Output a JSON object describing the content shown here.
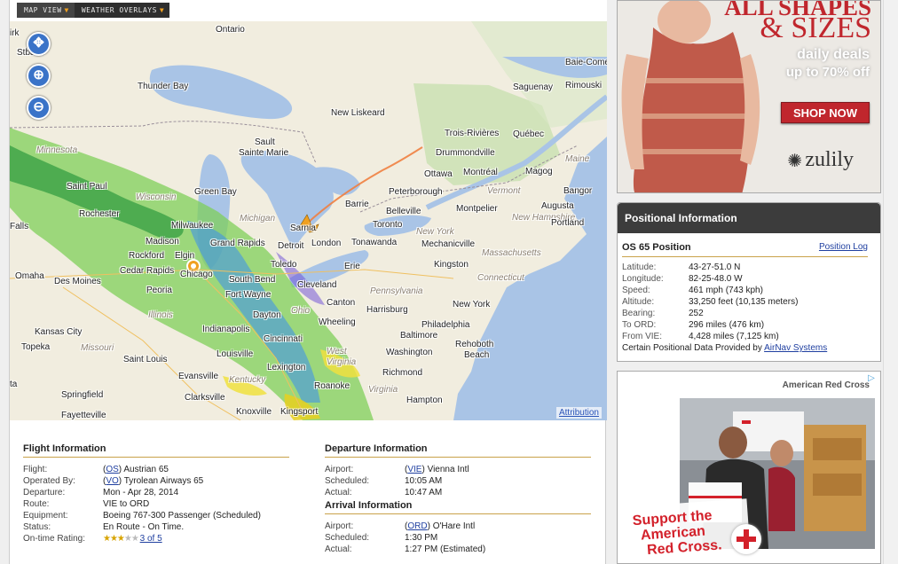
{
  "tabs": [
    {
      "label": "MAP VIEW",
      "active": true
    },
    {
      "label": "WEATHER OVERLAYS",
      "active": false
    }
  ],
  "map": {
    "attribution": "Attribution",
    "controls": {
      "pan": "pan-icon",
      "zoom_in": "zoom-in-icon",
      "zoom_out": "zoom-out-icon"
    },
    "labels": {
      "ontario": "Ontario",
      "sudbury_top": "Stbach",
      "kirk": "irk",
      "baie_comeau": "Baie-Comeau",
      "thunder_bay": "Thunder Bay",
      "saguenay": "Saguenay",
      "rimouski": "Rimouski",
      "new_liskeard": "New Liskeard",
      "trois_rivieres": "Trois-Rivières",
      "quebec": "Québec",
      "sault": "Sault",
      "sainte_marie": "Sainte Marie",
      "drummondville": "Drummondville",
      "minnesota": "Minnesota",
      "maine": "Maine",
      "ottawa": "Ottawa",
      "montreal": "Montréal",
      "magog": "Magog",
      "saint_paul": "Saint Paul",
      "wisconsin": "Wisconsin",
      "green_bay": "Green Bay",
      "peterborough": "Peterborough",
      "vermont": "Vermont",
      "bangor": "Bangor",
      "barrie": "Barrie",
      "belleville": "Belleville",
      "augusta": "Augusta",
      "rochester": "Rochester",
      "michigan": "Michigan",
      "montpelier": "Montpelier",
      "new_hampshire": "New Hampshire",
      "portland": "Portland",
      "falls": "Falls",
      "milwaukee": "Milwaukee",
      "sarnia": "Sarnia",
      "toronto": "Toronto",
      "madison": "Madison",
      "grand_rapids": "Grand Rapids",
      "london": "London",
      "tonawanda": "Tonawanda",
      "new_york_state": "New York",
      "mechanicville": "Mechanicville",
      "rockford": "Rockford",
      "elgin": "Elgin",
      "detroit": "Detroit",
      "massachusetts": "Massachusetts",
      "cedar_rapids": "Cedar Rapids",
      "chicago": "Chicago",
      "toledo": "Toledo",
      "erie": "Erie",
      "kingston": "Kingston",
      "omaha": "Omaha",
      "des_moines": "Des Moines",
      "south_bend": "South Bend",
      "cleveland": "Cleveland",
      "connecticut": "Connecticut",
      "peoria": "Peoria",
      "fort_wayne": "Fort Wayne",
      "pennsylvania": "Pennsylvania",
      "canton": "Canton",
      "harrisburg": "Harrisburg",
      "new_york": "New York",
      "illinois": "Illinois",
      "dayton": "Dayton",
      "ohio": "Ohio",
      "wheeling": "Wheeling",
      "philadelphia": "Philadelphia",
      "kansas_city": "Kansas City",
      "indianapolis": "Indianapolis",
      "cincinnati": "Cincinnati",
      "baltimore": "Baltimore",
      "rehoboth_beach": "Rehoboth",
      "beach": "Beach",
      "topeka": "Topeka",
      "missouri": "Missouri",
      "louisville": "Louisville",
      "west_virginia": "West",
      "virginia_w": "Virginia",
      "washington": "Washington",
      "saint_louis": "Saint Louis",
      "lexington": "Lexington",
      "evansville": "Evansville",
      "kentucky": "Kentucky",
      "richmond": "Richmond",
      "ta": "ta",
      "springfield": "Springfield",
      "roanoke": "Roanoke",
      "virginia": "Virginia",
      "clarksville": "Clarksville",
      "hampton": "Hampton",
      "knoxville": "Knoxville",
      "kingsport": "Kingsport",
      "fayetteville": "Fayetteville"
    }
  },
  "flight": {
    "title": "Flight Information",
    "rows": [
      {
        "key": "Flight:",
        "code": "OS",
        "value": " Austrian 65"
      },
      {
        "key": "Operated By:",
        "code": "VO",
        "value": " Tyrolean Airways 65"
      },
      {
        "key": "Departure:",
        "value": "Mon - Apr 28, 2014"
      },
      {
        "key": "Route:",
        "value": "VIE to ORD"
      },
      {
        "key": "Equipment:",
        "value": "Boeing 767-300 Passenger (Scheduled)"
      },
      {
        "key": "Status:",
        "value": "En Route - On Time."
      },
      {
        "key": "On-time Rating:",
        "stars": 3,
        "stars_max": 5,
        "link": "3 of 5"
      }
    ]
  },
  "departure": {
    "title": "Departure Information",
    "rows": [
      {
        "key": "Airport:",
        "code": "VIE",
        "value": " Vienna Intl"
      },
      {
        "key": "Scheduled:",
        "value": "10:05 AM"
      },
      {
        "key": "Actual:",
        "value": "10:47 AM"
      }
    ]
  },
  "arrival": {
    "title": "Arrival Information",
    "rows": [
      {
        "key": "Airport:",
        "code": "ORD",
        "value": " O'Hare Intl"
      },
      {
        "key": "Scheduled:",
        "value": "1:30 PM"
      },
      {
        "key": "Actual:",
        "value": "1:27 PM (Estimated)"
      }
    ]
  },
  "positional": {
    "header": "Positional Information",
    "title": "OS 65 Position",
    "log_link": "Position Log",
    "rows": [
      {
        "key": "Latitude:",
        "value": "43-27-51.0 N"
      },
      {
        "key": "Longitude:",
        "value": "82-25-48.0 W"
      },
      {
        "key": "Speed:",
        "value": "461 mph (743 kph)"
      },
      {
        "key": "Altitude:",
        "value": "33,250 feet (10,135 meters)"
      },
      {
        "key": "Bearing:",
        "value": "252"
      },
      {
        "key": "To ORD:",
        "value": "296 miles (476 km)"
      },
      {
        "key": "From VIE:",
        "value": "4,428 miles (7,125 km)"
      }
    ],
    "credit_text": "Certain Positional Data Provided by ",
    "credit_link": "AirNav Systems"
  },
  "ad_zulily": {
    "headline_1": "ALL SHAPES",
    "headline_2": "& SIZES",
    "line_1": "daily deals",
    "line_2": "up to 70% off",
    "button": "SHOP NOW",
    "brand": "zulily",
    "accent": "#c0262d"
  },
  "ad_redcross": {
    "brand": "American Red Cross",
    "line_1": "Support the",
    "line_2": "American",
    "line_3": "Red Cross.",
    "accent": "#d3202a"
  }
}
